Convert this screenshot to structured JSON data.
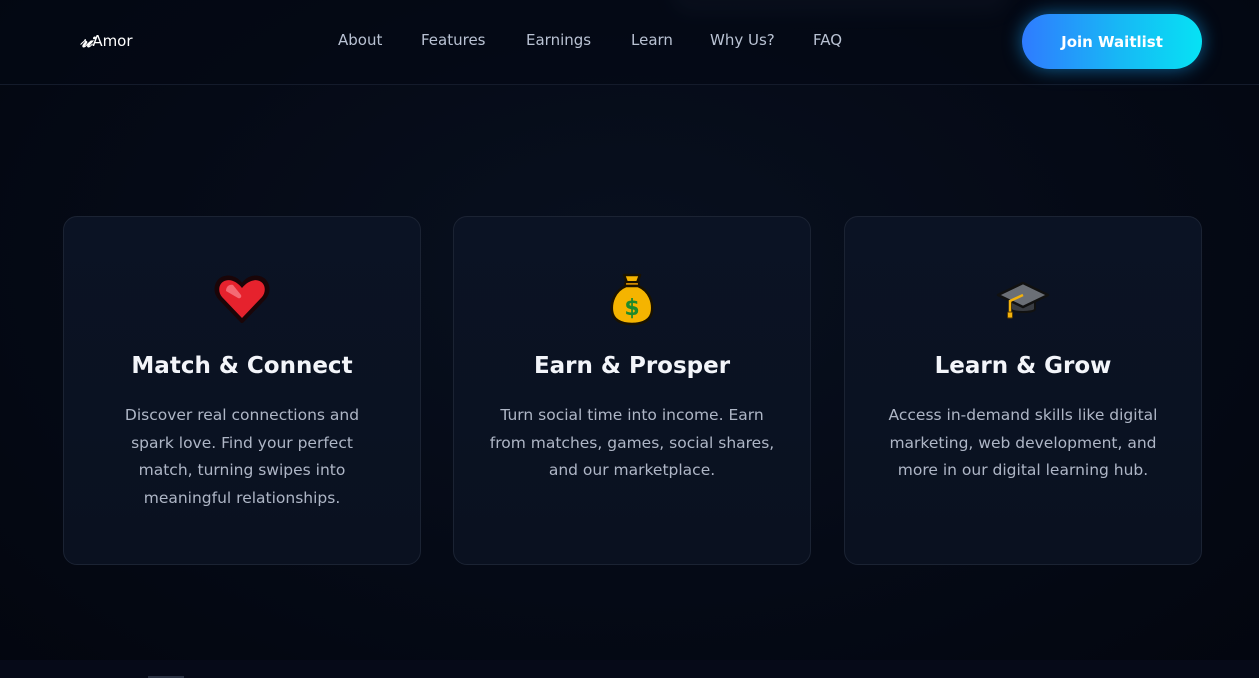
{
  "header": {
    "logo_mark": "𝓇𝒾",
    "logo_text": "Amor",
    "nav": [
      {
        "label": "About"
      },
      {
        "label": "Features"
      },
      {
        "label": "Earnings"
      },
      {
        "label": "Learn"
      },
      {
        "label": "Why Us?"
      },
      {
        "label": "FAQ"
      }
    ],
    "cta_label": "Join Waitlist"
  },
  "features": [
    {
      "icon": "heart-icon",
      "title": "Match & Connect",
      "description": "Discover real connections and spark love. Find your perfect match, turning swipes into meaningful relationships."
    },
    {
      "icon": "money-bag-icon",
      "title": "Earn & Prosper",
      "description": "Turn social time into income. Earn from matches, games, social shares, and our marketplace."
    },
    {
      "icon": "graduation-cap-icon",
      "title": "Learn & Grow",
      "description": "Access in-demand skills like digital marketing, web development, and more in our digital learning hub."
    }
  ],
  "colors": {
    "background": "#050914",
    "card": "#0b1324",
    "cta_start": "#2f7bff",
    "cta_end": "#06e2f4"
  }
}
